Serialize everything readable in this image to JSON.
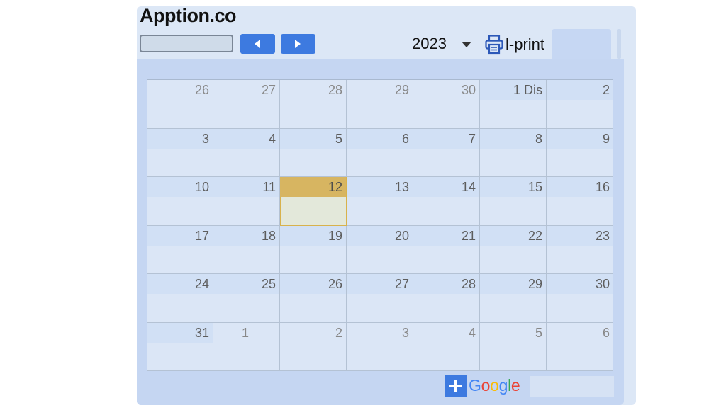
{
  "header": {
    "title": "Apption.co",
    "year": "2023",
    "print_label": "l-print"
  },
  "icons": {
    "prev": "triangle-left-icon",
    "next": "triangle-right-icon",
    "dropdown": "caret-down-icon",
    "print": "printer-icon",
    "add": "plus-icon"
  },
  "colors": {
    "accent": "#3d7ae0",
    "today": "#d7b561",
    "panel": "#c5d6f2"
  },
  "calendar": {
    "weeks": [
      [
        {
          "d": "26",
          "o": true
        },
        {
          "d": "27",
          "o": true
        },
        {
          "d": "28",
          "o": true
        },
        {
          "d": "29",
          "o": true
        },
        {
          "d": "30",
          "o": true
        },
        {
          "d": "1 Dis",
          "o": false
        },
        {
          "d": "2",
          "o": false
        }
      ],
      [
        {
          "d": "3",
          "o": false
        },
        {
          "d": "4",
          "o": false
        },
        {
          "d": "5",
          "o": false
        },
        {
          "d": "6",
          "o": false
        },
        {
          "d": "7",
          "o": false
        },
        {
          "d": "8",
          "o": false
        },
        {
          "d": "9",
          "o": false
        }
      ],
      [
        {
          "d": "10",
          "o": false
        },
        {
          "d": "11",
          "o": false
        },
        {
          "d": "12",
          "o": false,
          "today": true
        },
        {
          "d": "13",
          "o": false
        },
        {
          "d": "14",
          "o": false
        },
        {
          "d": "15",
          "o": false
        },
        {
          "d": "16",
          "o": false
        }
      ],
      [
        {
          "d": "17",
          "o": false
        },
        {
          "d": "18",
          "o": false
        },
        {
          "d": "19",
          "o": false
        },
        {
          "d": "20",
          "o": false
        },
        {
          "d": "21",
          "o": false
        },
        {
          "d": "22",
          "o": false
        },
        {
          "d": "23",
          "o": false
        }
      ],
      [
        {
          "d": "24",
          "o": false
        },
        {
          "d": "25",
          "o": false
        },
        {
          "d": "26",
          "o": false
        },
        {
          "d": "27",
          "o": false
        },
        {
          "d": "28",
          "o": false
        },
        {
          "d": "29",
          "o": false
        },
        {
          "d": "30",
          "o": false
        }
      ],
      [
        {
          "d": "31",
          "o": false
        },
        {
          "d": "1",
          "o": true
        },
        {
          "d": "2",
          "o": true
        },
        {
          "d": "3",
          "o": true
        },
        {
          "d": "4",
          "o": true
        },
        {
          "d": "5",
          "o": true
        },
        {
          "d": "6",
          "o": true
        }
      ]
    ]
  },
  "footer": {
    "google_letters": [
      {
        "ch": "G",
        "color": "#4285f4"
      },
      {
        "ch": "o",
        "color": "#ea4335"
      },
      {
        "ch": "o",
        "color": "#fbbc05"
      },
      {
        "ch": "g",
        "color": "#4285f4"
      },
      {
        "ch": "l",
        "color": "#34a853"
      },
      {
        "ch": "e",
        "color": "#ea4335"
      }
    ]
  }
}
